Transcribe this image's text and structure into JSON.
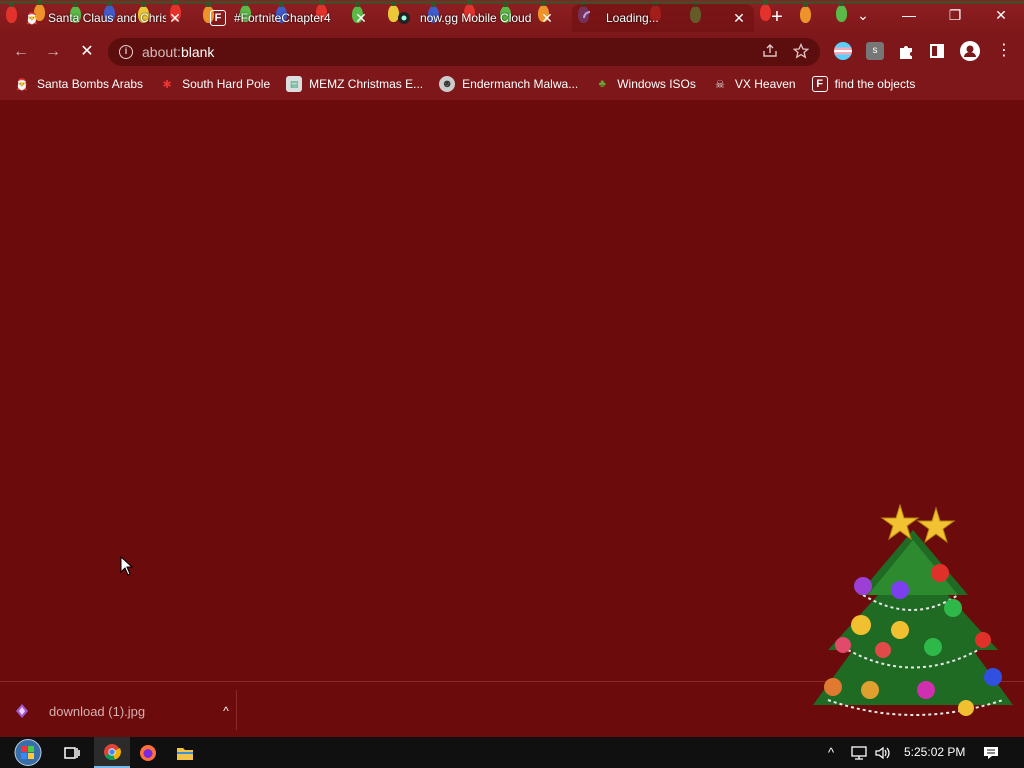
{
  "tabs": [
    {
      "title": "Santa Claus and Christ",
      "favicon": "santa-icon",
      "active": false
    },
    {
      "title": "#FortniteChapter4",
      "favicon": "fandom-icon",
      "active": false
    },
    {
      "title": "now.gg Mobile Cloud",
      "favicon": "nowgg-icon",
      "active": false
    },
    {
      "title": "Loading...",
      "favicon": "loading-spinner-icon",
      "active": true
    }
  ],
  "tab_close_glyph": "✕",
  "new_tab_glyph": "+",
  "window_controls": {
    "tab_search": "⌄",
    "minimize": "—",
    "restore": "❐",
    "close": "✕"
  },
  "toolbar": {
    "url_scheme": "about:",
    "url_path": "blank",
    "back_glyph": "←",
    "forward_glyph": "→",
    "stop_glyph": "✕"
  },
  "bookmarks": [
    {
      "label": "Santa Bombs Arabs",
      "icon": "santa-icon"
    },
    {
      "label": "South Hard Pole",
      "icon": "snowflake-icon"
    },
    {
      "label": "MEMZ Christmas E...",
      "icon": "memz-icon"
    },
    {
      "label": "Endermanch Malwa...",
      "icon": "endermanch-icon"
    },
    {
      "label": "Windows ISOs",
      "icon": "windows-isos-icon"
    },
    {
      "label": "VX Heaven",
      "icon": "vx-heaven-icon"
    },
    {
      "label": "find the objects",
      "icon": "fandom-icon"
    }
  ],
  "download": {
    "filename": "download (1).jpg",
    "chevron": "^"
  },
  "taskbar": {
    "clock": "5:25:02 PM",
    "tray_chevron": "^"
  },
  "colors": {
    "page_background": "#6b0b0b",
    "toolbar": "#7d1719",
    "omnibox": "#5c0d0e",
    "taskbar": "#101010"
  }
}
